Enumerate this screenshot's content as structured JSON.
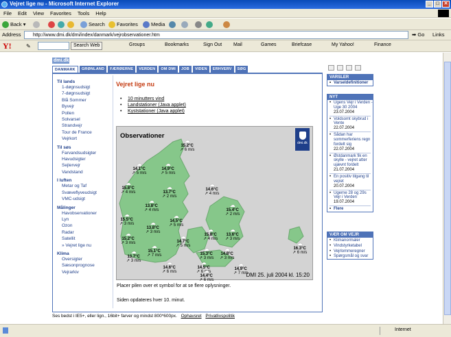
{
  "window": {
    "title": "Vejret lige nu - Microsoft Internet Explorer",
    "menu": [
      "File",
      "Edit",
      "View",
      "Favorites",
      "Tools",
      "Help"
    ],
    "toolbar": {
      "back": "Back",
      "search": "Search",
      "favorites": "Favorites",
      "media": "Media"
    },
    "address_label": "Address",
    "url": "http://www.dmi.dk/dmi/index/danmark/vejrobservationer.htm",
    "go": "Go",
    "links": "Links",
    "yahoo": {
      "search_button": "Search Web",
      "items": [
        "Groups",
        "Bookmarks",
        "Sign Out",
        "Mail",
        "Games",
        "Briefcase",
        "My Yahoo!",
        "Finance"
      ]
    },
    "status": "Internet"
  },
  "site": {
    "logo": "dmi.dk",
    "tabs": [
      "DANMARK",
      "GRØNLAND",
      "FÆRØERNE",
      "VERDEN",
      "OM DMI",
      "JOB",
      "VIDEN",
      "ERHVERV",
      "SØG"
    ],
    "left_nav": [
      {
        "section": "Til lands",
        "items": [
          "1-døgnsudsigt",
          "7-døgnsudsigt",
          "Blå Sommer",
          "Byvejr",
          "Pollen",
          "Solvarsel",
          "Strandvejr",
          "Tour de France",
          "Vejrkort"
        ]
      },
      {
        "section": "Til søs",
        "items": [
          "Farvandsudsigter",
          "Havudsigter",
          "Sejlervejr",
          "Vandstand"
        ]
      },
      {
        "section": "I luften",
        "items": [
          "Metar og Taf",
          "Svæveflyveudsigt",
          "VMC-udsigt"
        ]
      },
      {
        "section": "Målinger",
        "items": [
          "Havobservationer",
          "Lyn",
          "Ozon",
          "Radar",
          "Satellit",
          "» Vejret lige nu"
        ]
      },
      {
        "section": "Klima",
        "items": [
          "Oversigter",
          "Sæsonprognose",
          "Vejrarkiv"
        ]
      }
    ],
    "content": {
      "title": "Vejret lige nu",
      "links": [
        "10 minutters vind",
        "Landstationer (Java applet)",
        "Kyststationer (Java applet)"
      ],
      "map": {
        "title": "Observationer",
        "timestamp": "DMI 25. juli 2004 kl. 15:20",
        "stations": [
          {
            "t": "15.2°C",
            "w": "6 m/s"
          },
          {
            "t": "14.1°C",
            "w": "5 m/s"
          },
          {
            "t": "14.9°C",
            "w": "5 m/s"
          },
          {
            "t": "15.8°C",
            "w": "4 m/s"
          },
          {
            "t": "13.7°C",
            "w": "2 m/s"
          },
          {
            "t": "14.6°C",
            "w": "4 m/s"
          },
          {
            "t": "13.8°C",
            "w": "4 m/s"
          },
          {
            "t": "15.5°C",
            "w": "3 m/s"
          },
          {
            "t": "13.8°C",
            "w": "3 m/s"
          },
          {
            "t": "14.5°C",
            "w": "5 m/s"
          },
          {
            "t": "15.4°C",
            "w": "2 m/s"
          },
          {
            "t": "15.8°C",
            "w": "4 m/s"
          },
          {
            "t": "13.6°C",
            "w": "3 m/s"
          },
          {
            "t": "15.2°C",
            "w": "3 m/s"
          },
          {
            "t": "14.7°C",
            "w": "5 m/s"
          },
          {
            "t": "15.3°C",
            "w": "3 m/s"
          },
          {
            "t": "15.1°C",
            "w": "7 m/s"
          },
          {
            "t": "13.7°C",
            "w": "3 m/s"
          },
          {
            "t": "14.6°C",
            "w": "6 m/s"
          },
          {
            "t": "14.5°C",
            "w": "6 m/s"
          },
          {
            "t": "14.8°C",
            "w": "3 m/s"
          },
          {
            "t": "14.9°C",
            "w": "7 m/s"
          },
          {
            "t": "14.4°C",
            "w": "6 m/s"
          },
          {
            "t": "16.3°C",
            "w": "6 m/s"
          }
        ]
      },
      "hint": "Placer pilen over et symbol for at se flere oplysninger.",
      "update": "Siden opdateres hver 10. minut."
    },
    "right": {
      "varsler": {
        "header": "VARSLER",
        "items": [
          "Varseldefinitioner"
        ]
      },
      "nyt": {
        "header": "NYT",
        "items": [
          {
            "text": "Ugens Vejr i Verden - Uge 30 2004",
            "date": "23.07.2004"
          },
          {
            "text": "Voldsomt skybrud i Vente",
            "date": "22.07.2004"
          },
          {
            "text": "Sådan har sommerferiens regn fordelt sig",
            "date": "22.07.2004"
          },
          {
            "text": "Østdanmark fik en skylle - vejret atter ujævnt fordelt",
            "date": "21.07.2004"
          },
          {
            "text": "En positiv tilgang til vejret",
            "date": "20.07.2004"
          },
          {
            "text": "Ugerne 28 og 29s Vejr i Verden",
            "date": "19.07.2004"
          },
          {
            "text": "Flere",
            "date": ""
          }
        ]
      },
      "vaer": {
        "header": "VÆR OM VEJR",
        "items": [
          "Klimanormaler",
          "Vindstyrketabel",
          "Vejrlommeregner",
          "Spørgsmål og svar"
        ]
      }
    },
    "footer": {
      "text": "Ses bedst i IE5+, eller lign., 16bit+ farver og mindst 800*600px.",
      "links": [
        "Ophavsret",
        "Privatlivspolitik"
      ]
    }
  }
}
